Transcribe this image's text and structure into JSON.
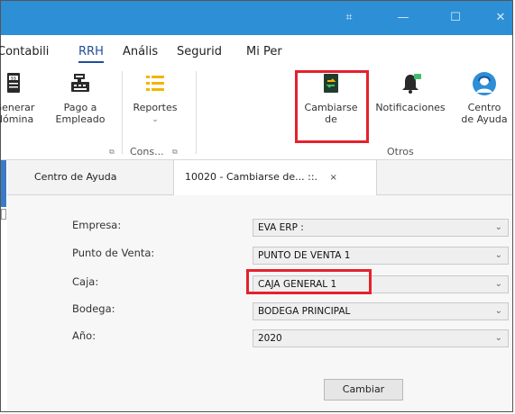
{
  "window": {
    "buttons": [
      "⌗",
      "—",
      "☐",
      "✕"
    ]
  },
  "menu": {
    "items": [
      "Contabili",
      "RRH",
      "Anális",
      "Segurid",
      "Mi Per"
    ]
  },
  "ribbon": {
    "buttons": {
      "generar": [
        "Generar",
        "Nómina"
      ],
      "pago": [
        "Pago a",
        "Empleado"
      ],
      "reportes": "Reportes",
      "cambiarse": [
        "Cambiarse",
        "de"
      ],
      "notificaciones": "Notificaciones",
      "centro": [
        "Centro",
        "de Ayuda"
      ]
    },
    "groups": {
      "cons": "Cons...",
      "otros": "Otros"
    }
  },
  "tabs": {
    "items": [
      "Centro de Ayuda",
      "10020 - Cambiarse de... ::."
    ],
    "close": "×"
  },
  "form": {
    "fields": [
      {
        "label": "Empresa:",
        "value": "EVA ERP :"
      },
      {
        "label": "Punto de Venta:",
        "value": "PUNTO DE VENTA 1"
      },
      {
        "label": "Caja:",
        "value": "CAJA GENERAL 1"
      },
      {
        "label": "Bodega:",
        "value": "BODEGA PRINCIPAL"
      },
      {
        "label": "Año:",
        "value": "2020"
      }
    ],
    "submit": "Cambiar"
  },
  "colors": {
    "titlebar": "#2d8fd5",
    "highlight": "#e3222d",
    "accent": "#1f4e99"
  }
}
